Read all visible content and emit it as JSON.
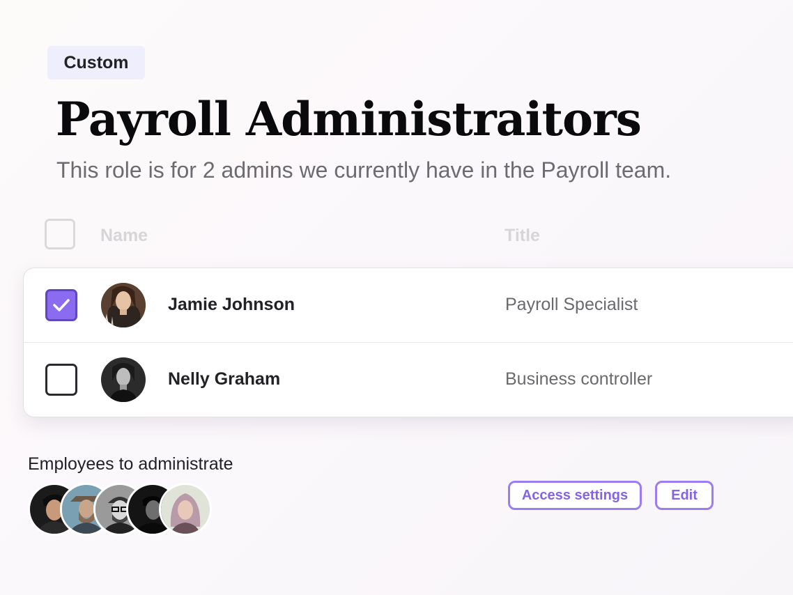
{
  "badge": {
    "label": "Custom"
  },
  "role": {
    "title": "Payroll Administraitors",
    "description": "This role is for 2 admins we currently have in the Payroll team."
  },
  "table": {
    "columns": {
      "name": "Name",
      "title": "Title"
    },
    "rows": [
      {
        "name": "Jamie Johnson",
        "title": "Payroll Specialist",
        "checked": true
      },
      {
        "name": "Nelly Graham",
        "title": "Business controller",
        "checked": false
      }
    ]
  },
  "employees": {
    "label": "Employees to administrate",
    "avatar_count": 5
  },
  "actions": {
    "access_settings": "Access settings",
    "edit": "Edit"
  },
  "colors": {
    "accent": "#8b6cf0",
    "badge_bg": "#efeefc",
    "button_border": "#9c7cf2"
  }
}
